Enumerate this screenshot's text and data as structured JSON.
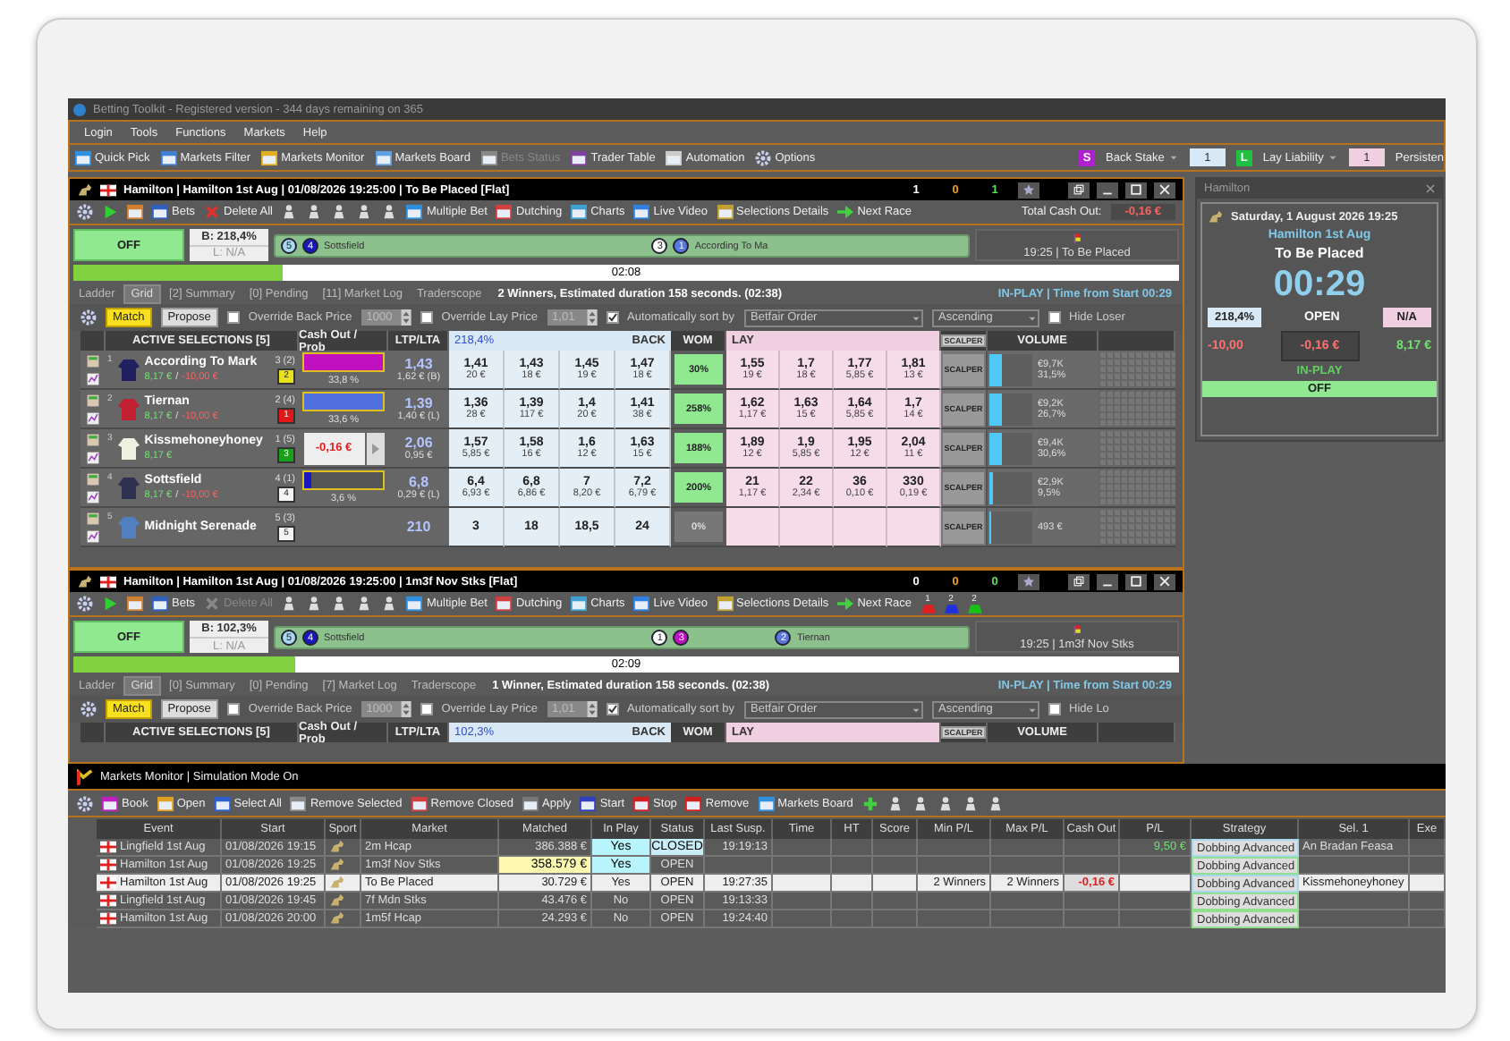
{
  "window": {
    "title": "Betting Toolkit - Registered version - 344 days remaining on 365"
  },
  "menu": [
    "Login",
    "Tools",
    "Functions",
    "Markets",
    "Help"
  ],
  "toolbar": {
    "items": [
      {
        "label": "Quick Pick",
        "disabled": false
      },
      {
        "label": "Markets Filter",
        "disabled": false
      },
      {
        "label": "Markets Monitor",
        "disabled": false
      },
      {
        "label": "Markets Board",
        "disabled": false
      },
      {
        "label": "Bets Status",
        "disabled": true
      },
      {
        "label": "Trader Table",
        "disabled": false
      },
      {
        "label": "Automation",
        "disabled": false
      },
      {
        "label": "Options",
        "disabled": false
      }
    ],
    "back_stake": {
      "key": "S",
      "label": "Back Stake",
      "value": "1"
    },
    "lay_liability": {
      "key": "L",
      "label": "Lay Liability",
      "value": "1"
    },
    "overflow": "Persisten"
  },
  "markets": [
    {
      "title": "Hamilton | Hamilton 1st Aug | 01/08/2026 19:25:00 | To Be Placed [Flat]",
      "counters": [
        "1",
        "0",
        "1"
      ],
      "toolbar": {
        "bets": "Bets",
        "delete_all": {
          "label": "Delete All",
          "disabled": false
        },
        "tools": [
          "Multiple Bet",
          "Dutching",
          "Charts",
          "Live Video",
          "Selections Details",
          "Next Race"
        ],
        "total_cash_out": {
          "label": "Total Cash Out:",
          "value": "-0,16 €"
        }
      },
      "status": {
        "state": "OFF",
        "back_book": "B: 218,4%",
        "lay_book": "L: N/A",
        "race": "19:25 | To Be Placed"
      },
      "track": [
        [
          {
            "label": "5",
            "color": "#a8d8f0"
          },
          {
            "label": "4",
            "color": "#1818c0"
          },
          {
            "label": "Sottsfield"
          }
        ],
        [
          {
            "label": "3",
            "color": "#ffffff"
          },
          {
            "label": "1",
            "color": "#5878e0"
          },
          {
            "label": "According To Ma"
          }
        ]
      ],
      "progress": {
        "level": 0.19,
        "time": "02:08"
      },
      "tabs": [
        {
          "label": "Ladder",
          "selected": false
        },
        {
          "label": "Grid",
          "selected": true
        },
        {
          "label": "[2] Summary",
          "selected": false
        },
        {
          "label": "[0] Pending",
          "selected": false
        },
        {
          "label": "[11] Market Log",
          "selected": false
        },
        {
          "label": "Traderscope",
          "selected": false
        }
      ],
      "info": "2 Winners, Estimated duration 158 seconds. (02:38)",
      "clock": "IN-PLAY | Time from Start 00:29",
      "options": {
        "match": "Match",
        "propose": "Propose",
        "override_back": {
          "label": "Override Back Price",
          "checked": false,
          "value": "1000"
        },
        "override_lay": {
          "label": "Override Lay Price",
          "checked": false,
          "value": "1,01"
        },
        "auto_sort": {
          "label": "Automatically sort by",
          "checked": true
        },
        "sort_field": "Betfair Order",
        "sort_order": "Ascending",
        "hide_loser": {
          "label": "Hide Loser",
          "checked": false
        }
      },
      "grid": {
        "columns": {
          "selections": "ACTIVE SELECTIONS [5]",
          "cash_out": "Cash Out / Prob",
          "ltp": "LTP/LTA",
          "book": "218,4%",
          "back": "BACK",
          "wom": "WOM",
          "lay": "LAY",
          "scalper": "SCALPER",
          "volume": "VOLUME"
        },
        "rows": [
          {
            "number": "1",
            "name": "According To Mark",
            "silk": {
              "color": "#202060"
            },
            "stakes": [
              {
                "text": "8,17 €",
                "kind": "profit"
              },
              {
                "text": "/",
                "kind": "sep"
              },
              {
                "text": "-10,00 €",
                "kind": "loss"
              }
            ],
            "rank": "3 (2)",
            "badge": {
              "label": "2",
              "color": "#e8e020"
            },
            "cash_out": {
              "kind": "bar",
              "level": 1,
              "color": "#c010c0",
              "prob": "33,8 %"
            },
            "ltp": "1,43",
            "lta": "1,62 € (B)",
            "back": [
              [
                "1,41",
                "20 €"
              ],
              [
                "1,43",
                "18 €"
              ],
              [
                "1,45",
                "19 €"
              ],
              [
                "1,47",
                "18 €"
              ]
            ],
            "wom": {
              "text": "30%",
              "high": true
            },
            "lay": [
              [
                "1,55",
                "19 €"
              ],
              [
                "1,7",
                "18 €"
              ],
              [
                "1,77",
                "5,85 €"
              ],
              [
                "1,81",
                "13 €"
              ]
            ],
            "scalper": "SCALPER",
            "volume": {
              "level": 0.3,
              "amount": "€9,7K",
              "share": "31,5%"
            }
          },
          {
            "number": "2",
            "name": "Tiernan",
            "silk": {
              "color": "#c02030"
            },
            "stakes": [
              {
                "text": "8,17 €",
                "kind": "profit"
              },
              {
                "text": "/",
                "kind": "sep"
              },
              {
                "text": "-10,00 €",
                "kind": "loss"
              }
            ],
            "rank": "2 (4)",
            "badge": {
              "label": "1",
              "color": "#e01818"
            },
            "cash_out": {
              "kind": "bar",
              "level": 1,
              "color": "#5070e0",
              "prob": "33,6 %"
            },
            "ltp": "1,39",
            "lta": "1,40 € (L)",
            "back": [
              [
                "1,36",
                "28 €"
              ],
              [
                "1,39",
                "117 €"
              ],
              [
                "1,4",
                "20 €"
              ],
              [
                "1,41",
                "38 €"
              ]
            ],
            "wom": {
              "text": "258%",
              "high": true
            },
            "lay": [
              [
                "1,62",
                "1,17 €"
              ],
              [
                "1,63",
                "15 €"
              ],
              [
                "1,64",
                "5,85 €"
              ],
              [
                "1,7",
                "14 €"
              ]
            ],
            "scalper": "SCALPER",
            "volume": {
              "level": 0.28,
              "amount": "€9,2K",
              "share": "26,7%"
            }
          },
          {
            "number": "3",
            "name": "Kissmehoneyhoney",
            "silk": {
              "color": "#f0f0e0"
            },
            "stakes": [
              {
                "text": "8,17 €",
                "kind": "profit"
              }
            ],
            "rank": "1 (5)",
            "badge": {
              "label": "3",
              "color": "#18a018"
            },
            "cash_out": {
              "kind": "button",
              "value": "-0,16 €"
            },
            "ltp": "2,06",
            "lta": "0,95 €",
            "back": [
              [
                "1,57",
                "5,85 €"
              ],
              [
                "1,58",
                "16 €"
              ],
              [
                "1,6",
                "12 €"
              ],
              [
                "1,63",
                "15 €"
              ]
            ],
            "wom": {
              "text": "188%",
              "high": true
            },
            "lay": [
              [
                "1,89",
                "12 €"
              ],
              [
                "1,9",
                "5,85 €"
              ],
              [
                "1,95",
                "12 €"
              ],
              [
                "2,04",
                "11 €"
              ]
            ],
            "scalper": "SCALPER",
            "volume": {
              "level": 0.3,
              "amount": "€9,4K",
              "share": "30,6%"
            }
          },
          {
            "number": "4",
            "name": "Sottsfield",
            "silk": {
              "color": "#303050"
            },
            "stakes": [
              {
                "text": "8,17 €",
                "kind": "profit"
              },
              {
                "text": "/",
                "kind": "sep"
              },
              {
                "text": "-10,00 €",
                "kind": "loss"
              }
            ],
            "rank": "4 (1)",
            "badge": {
              "label": "4",
              "color": "#f4f4f4"
            },
            "cash_out": {
              "kind": "bar",
              "level": 0.1,
              "color": "#1818c0",
              "prob": "3,6 %"
            },
            "ltp": "6,8",
            "lta": "0,29 € (L)",
            "back": [
              [
                "6,4",
                "6,93 €"
              ],
              [
                "6,8",
                "6,86 €"
              ],
              [
                "7",
                "8,20 €"
              ],
              [
                "7,2",
                "6,79 €"
              ]
            ],
            "wom": {
              "text": "200%",
              "high": true
            },
            "lay": [
              [
                "21",
                "1,17 €"
              ],
              [
                "22",
                "2,34 €"
              ],
              [
                "36",
                "0,10 €"
              ],
              [
                "330",
                "0,19 €"
              ]
            ],
            "scalper": "SCALPER",
            "volume": {
              "level": 0.08,
              "amount": "€2,9K",
              "share": "9,5%"
            }
          },
          {
            "number": "5",
            "name": "Midnight Serenade",
            "silk": {
              "color": "#5080c0"
            },
            "rank": "5 (3)",
            "badge": {
              "label": "5",
              "color": "#f4f4f4"
            },
            "ltp": "210",
            "back": [
              [
                "3"
              ],
              [
                "18"
              ],
              [
                "18,5"
              ],
              [
                "24"
              ]
            ],
            "wom": {
              "text": "0%",
              "high": false
            },
            "scalper": "SCALPER",
            "volume": {
              "level": 0.02,
              "amount": "493 €"
            }
          }
        ]
      }
    },
    {
      "title": "Hamilton | Hamilton 1st Aug | 01/08/2026 19:25:00 | 1m3f Nov Stks [Flat]",
      "counters": [
        "0",
        "0",
        "0"
      ],
      "toolbar": {
        "bets": "Bets",
        "delete_all": {
          "label": "Delete All",
          "disabled": true
        },
        "tools": [
          "Multiple Bet",
          "Dutching",
          "Charts",
          "Live Video",
          "Selections Details",
          "Next Race"
        ],
        "silk_markers": [
          {
            "label": "1",
            "color": "#e02020"
          },
          {
            "label": "2",
            "color": "#2030e0"
          },
          {
            "label": "2",
            "color": "#18c018"
          }
        ]
      },
      "status": {
        "state": "OFF",
        "back_book": "B: 102,3%",
        "lay_book": "L: N/A",
        "race": "19:25 | 1m3f Nov Stks"
      },
      "track": [
        [
          {
            "label": "5",
            "color": "#a8d8f0"
          },
          {
            "label": "4",
            "color": "#1818c0"
          },
          {
            "label": "Sottsfield"
          }
        ],
        [
          {
            "label": "1",
            "color": "#ffffff"
          },
          {
            "label": "3",
            "color": "#c010c0"
          }
        ],
        [
          {
            "label": "2",
            "color": "#5878e0"
          },
          {
            "label": "Tiernan"
          }
        ]
      ],
      "progress": {
        "level": 0.2,
        "time": "02:09"
      },
      "tabs": [
        {
          "label": "Ladder",
          "selected": false
        },
        {
          "label": "Grid",
          "selected": true
        },
        {
          "label": "[0] Summary",
          "selected": false
        },
        {
          "label": "[0] Pending",
          "selected": false
        },
        {
          "label": "[7] Market Log",
          "selected": false
        },
        {
          "label": "Traderscope",
          "selected": false
        }
      ],
      "info": "1 Winner, Estimated duration 158 seconds. (02:38)",
      "clock": "IN-PLAY | Time from Start 00:29",
      "options": {
        "match": "Match",
        "propose": "Propose",
        "override_back": {
          "label": "Override Back Price",
          "checked": false,
          "value": "1000"
        },
        "override_lay": {
          "label": "Override Lay Price",
          "checked": false,
          "value": "1,01"
        },
        "auto_sort": {
          "label": "Automatically sort by",
          "checked": true
        },
        "sort_field": "Betfair Order",
        "sort_order": "Ascending",
        "hide_loser": {
          "label": "Hide Lo",
          "checked": false
        }
      },
      "grid": {
        "columns": {
          "selections": "ACTIVE SELECTIONS [5]",
          "cash_out": "Cash Out / Prob",
          "ltp": "LTP/LTA",
          "book": "102,3%",
          "back": "BACK",
          "wom": "WOM",
          "lay": "LAY",
          "scalper": "SCALPER",
          "volume": "VOLUME"
        }
      }
    }
  ],
  "side_panel": {
    "title": "Hamilton",
    "date": "Saturday, 1 August 2026 19:25",
    "event": "Hamilton 1st Aug",
    "market": "To Be Placed",
    "countdown": "00:29",
    "back_book": "218,4%",
    "status": "OPEN",
    "lay_book": "N/A",
    "loss": "-10,00",
    "cash_out": "-0,16 €",
    "profit": "8,17 €",
    "state": "IN-PLAY",
    "switch": "OFF"
  },
  "monitor": {
    "title": "Markets Monitor | Simulation Mode On",
    "toolbar": [
      "Book",
      "Open",
      "Select All",
      "Remove Selected",
      "Remove Closed",
      "Apply",
      "Start",
      "Stop",
      "Remove",
      "Markets Board"
    ],
    "columns": [
      "Event",
      "Start",
      "Sport",
      "Market",
      "Matched",
      "In Play",
      "Status",
      "Last Susp.",
      "Time",
      "HT",
      "Score",
      "Min P/L",
      "Max P/L",
      "Cash Out",
      "P/L",
      "Strategy",
      "Sel. 1",
      "Exe"
    ],
    "rows": [
      {
        "selected": false,
        "cells": [
          "Lingfield 1st Aug",
          "01/08/2026 19:15",
          null,
          "2m Hcap",
          "386.388 €",
          {
            "text": "Yes",
            "kind": "live"
          },
          {
            "text": "CLOSED",
            "kind": "closed"
          },
          "19:19:13",
          null,
          null,
          null,
          null,
          null,
          null,
          {
            "text": "9,50 €",
            "kind": "gain"
          },
          {
            "text": "Dobbing Advanced",
            "kind": "strategy",
            "color": "#a8d8f0"
          },
          "An Bradan Feasa",
          null
        ]
      },
      {
        "selected": false,
        "cells": [
          "Hamilton 1st Aug",
          "01/08/2026 19:25",
          null,
          "1m3f Nov Stks",
          {
            "text": "358.579 €",
            "kind": "hot"
          },
          {
            "text": "Yes",
            "kind": "live"
          },
          "OPEN",
          null,
          null,
          null,
          null,
          null,
          null,
          null,
          null,
          {
            "text": "Dobbing Advanced",
            "kind": "strategy",
            "color": "#90e090"
          },
          null,
          null
        ]
      },
      {
        "selected": true,
        "cells": [
          "Hamilton 1st Aug",
          "01/08/2026 19:25",
          null,
          "To Be Placed",
          "30.729 €",
          "Yes",
          "OPEN",
          "19:27:35",
          null,
          null,
          null,
          "2 Winners",
          "2 Winners",
          {
            "text": "-0,16 €",
            "kind": "loss"
          },
          null,
          {
            "text": "Dobbing Advanced",
            "kind": "strategy",
            "color": "#a8d8f0"
          },
          "Kissmehoneyhoney",
          null
        ]
      },
      {
        "selected": false,
        "cells": [
          "Lingfield 1st Aug",
          "01/08/2026 19:45",
          null,
          "7f Mdn Stks",
          "43.476 €",
          "No",
          "OPEN",
          "19:13:33",
          null,
          null,
          null,
          null,
          null,
          null,
          null,
          {
            "text": "Dobbing Advanced",
            "kind": "strategy",
            "color": "#90e090"
          },
          null,
          null
        ]
      },
      {
        "selected": false,
        "cells": [
          "Hamilton 1st Aug",
          "01/08/2026 20:00",
          null,
          "1m5f Hcap",
          "24.293 €",
          "No",
          "OPEN",
          "19:24:40",
          null,
          null,
          null,
          null,
          null,
          null,
          null,
          {
            "text": "Dobbing Advanced",
            "kind": "strategy",
            "color": "#90e090"
          },
          null,
          null
        ]
      }
    ]
  }
}
